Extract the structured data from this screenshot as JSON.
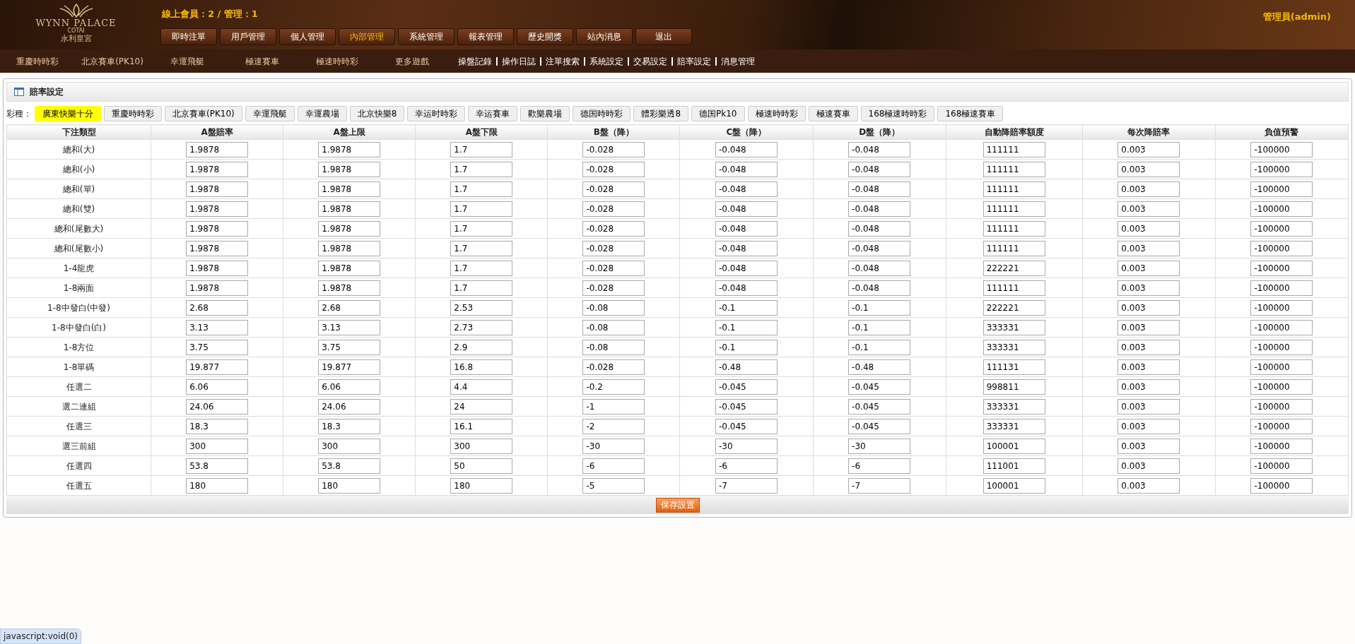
{
  "header": {
    "logo": {
      "name": "WYNN PALACE",
      "sub": "COTAI",
      "cn": "永利皇宮"
    },
    "online": "線上會員：2 / 管理：1",
    "user": "管理員(admin)",
    "menu": [
      {
        "label": "即時注單",
        "selected": false
      },
      {
        "label": "用戶管理",
        "selected": false
      },
      {
        "label": "個人管理",
        "selected": false
      },
      {
        "label": "內部管理",
        "selected": true
      },
      {
        "label": "系統管理",
        "selected": false
      },
      {
        "label": "報表管理",
        "selected": false
      },
      {
        "label": "歷史開獎",
        "selected": false
      },
      {
        "label": "站內消息",
        "selected": false
      },
      {
        "label": "退出",
        "selected": false
      }
    ]
  },
  "games_nav": [
    "重慶時時彩",
    "北京賽車(PK10)",
    "幸運飛艇",
    "極速賽車",
    "極速時時彩",
    "更多遊戲"
  ],
  "admin_links": [
    "操盤記錄",
    "操作日誌",
    "注單搜索",
    "系統設定",
    "交易設定",
    "賠率設定",
    "消息管理"
  ],
  "panel": {
    "title": "賠率設定",
    "lottery_label": "彩種：",
    "lotteries": [
      {
        "label": "廣東快樂十分",
        "selected": true
      },
      {
        "label": "重慶時時彩",
        "selected": false
      },
      {
        "label": "北京賽車(PK10)",
        "selected": false
      },
      {
        "label": "幸運飛艇",
        "selected": false
      },
      {
        "label": "幸運農場",
        "selected": false
      },
      {
        "label": "北京快樂8",
        "selected": false
      },
      {
        "label": "幸运时時彩",
        "selected": false
      },
      {
        "label": "幸运賽車",
        "selected": false
      },
      {
        "label": "歡樂農場",
        "selected": false
      },
      {
        "label": "德国時時彩",
        "selected": false
      },
      {
        "label": "體彩樂透8",
        "selected": false
      },
      {
        "label": "德国Pk10",
        "selected": false
      },
      {
        "label": "極速時時彩",
        "selected": false
      },
      {
        "label": "極速賽車",
        "selected": false
      },
      {
        "label": "168極速時時彩",
        "selected": false
      },
      {
        "label": "168極速賽車",
        "selected": false
      }
    ],
    "table": {
      "columns": [
        "下注類型",
        "A盤賠率",
        "A盤上限",
        "A盤下限",
        "B盤（降）",
        "C盤（降）",
        "D盤（降）",
        "自動降賠率額度",
        "每次降賠率",
        "負值預警"
      ],
      "rows": [
        {
          "type": "總和(大)",
          "values": [
            "1.9878",
            "1.9878",
            "1.7",
            "-0.028",
            "-0.048",
            "-0.048",
            "111111",
            "0.003",
            "-100000"
          ]
        },
        {
          "type": "總和(小)",
          "values": [
            "1.9878",
            "1.9878",
            "1.7",
            "-0.028",
            "-0.048",
            "-0.048",
            "111111",
            "0.003",
            "-100000"
          ]
        },
        {
          "type": "總和(單)",
          "values": [
            "1.9878",
            "1.9878",
            "1.7",
            "-0.028",
            "-0.048",
            "-0.048",
            "111111",
            "0.003",
            "-100000"
          ]
        },
        {
          "type": "總和(雙)",
          "values": [
            "1.9878",
            "1.9878",
            "1.7",
            "-0.028",
            "-0.048",
            "-0.048",
            "111111",
            "0.003",
            "-100000"
          ]
        },
        {
          "type": "總和(尾數大)",
          "values": [
            "1.9878",
            "1.9878",
            "1.7",
            "-0.028",
            "-0.048",
            "-0.048",
            "111111",
            "0.003",
            "-100000"
          ]
        },
        {
          "type": "總和(尾數小)",
          "values": [
            "1.9878",
            "1.9878",
            "1.7",
            "-0.028",
            "-0.048",
            "-0.048",
            "111111",
            "0.003",
            "-100000"
          ]
        },
        {
          "type": "1-4龍虎",
          "values": [
            "1.9878",
            "1.9878",
            "1.7",
            "-0.028",
            "-0.048",
            "-0.048",
            "222221",
            "0.003",
            "-100000"
          ]
        },
        {
          "type": "1-8兩面",
          "values": [
            "1.9878",
            "1.9878",
            "1.7",
            "-0.028",
            "-0.048",
            "-0.048",
            "111111",
            "0.003",
            "-100000"
          ]
        },
        {
          "type": "1-8中發白(中發)",
          "values": [
            "2.68",
            "2.68",
            "2.53",
            "-0.08",
            "-0.1",
            "-0.1",
            "222221",
            "0.003",
            "-100000"
          ]
        },
        {
          "type": "1-8中發白(白)",
          "values": [
            "3.13",
            "3.13",
            "2.73",
            "-0.08",
            "-0.1",
            "-0.1",
            "333331",
            "0.003",
            "-100000"
          ]
        },
        {
          "type": "1-8方位",
          "values": [
            "3.75",
            "3.75",
            "2.9",
            "-0.08",
            "-0.1",
            "-0.1",
            "333331",
            "0.003",
            "-100000"
          ]
        },
        {
          "type": "1-8單碼",
          "values": [
            "19.877",
            "19.877",
            "16.8",
            "-0.028",
            "-0.48",
            "-0.48",
            "111131",
            "0.003",
            "-100000"
          ]
        },
        {
          "type": "任選二",
          "values": [
            "6.06",
            "6.06",
            "4.4",
            "-0.2",
            "-0.045",
            "-0.045",
            "998811",
            "0.003",
            "-100000"
          ]
        },
        {
          "type": "選二連組",
          "values": [
            "24.06",
            "24.06",
            "24",
            "-1",
            "-0.045",
            "-0.045",
            "333331",
            "0.003",
            "-100000"
          ]
        },
        {
          "type": "任選三",
          "values": [
            "18.3",
            "18.3",
            "16.1",
            "-2",
            "-0.045",
            "-0.045",
            "333331",
            "0.003",
            "-100000"
          ]
        },
        {
          "type": "選三前組",
          "values": [
            "300",
            "300",
            "300",
            "-30",
            "-30",
            "-30",
            "100001",
            "0.003",
            "-100000"
          ]
        },
        {
          "type": "任選四",
          "values": [
            "53.8",
            "53.8",
            "50",
            "-6",
            "-6",
            "-6",
            "111001",
            "0.003",
            "-100000"
          ]
        },
        {
          "type": "任選五",
          "values": [
            "180",
            "180",
            "180",
            "-5",
            "-7",
            "-7",
            "100001",
            "0.003",
            "-100000"
          ]
        }
      ]
    },
    "save_button": "保存設置"
  },
  "status_bar": "javascript:void(0)"
}
